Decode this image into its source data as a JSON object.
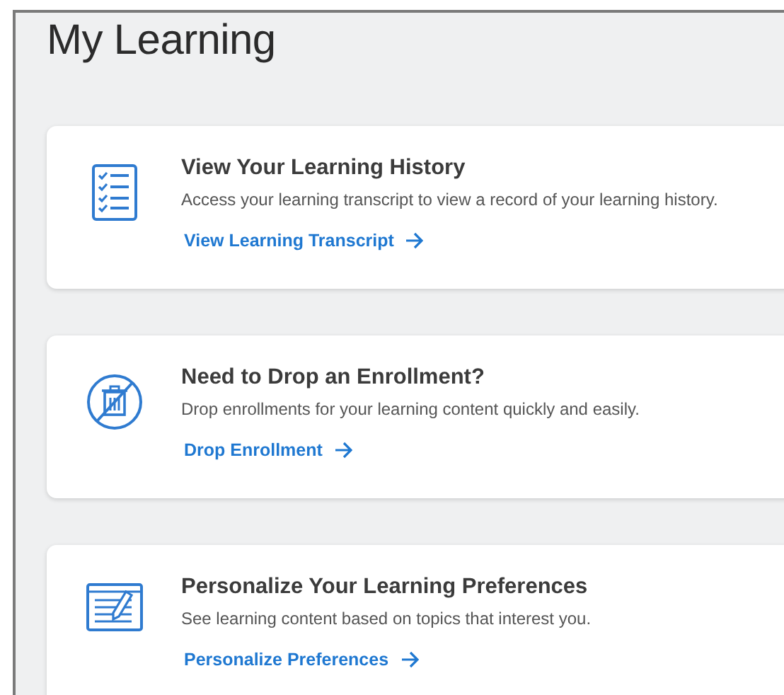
{
  "page": {
    "title": "My Learning"
  },
  "cards": [
    {
      "kind": "checklist",
      "title": "View Your Learning History",
      "description": "Access your learning transcript to view a record of your learning history.",
      "link": "View Learning Transcript"
    },
    {
      "kind": "no-trash",
      "title": "Need to Drop an Enrollment?",
      "description": "Drop enrollments for your learning content quickly and easily.",
      "link": "Drop Enrollment"
    },
    {
      "kind": "edit-document",
      "title": "Personalize Your Learning Preferences",
      "description": "See learning content based on topics that interest you.",
      "link": "Personalize Preferences"
    }
  ]
}
